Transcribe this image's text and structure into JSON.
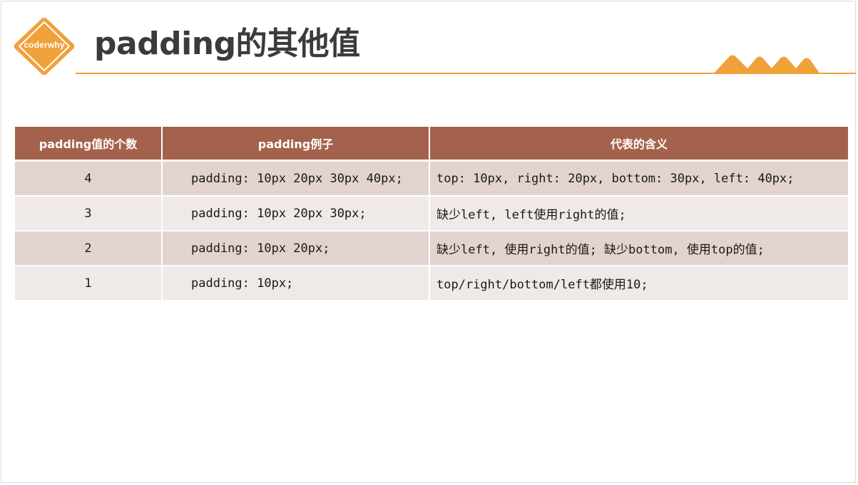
{
  "logo": {
    "text": "coderwhy",
    "color": "#f0a13a"
  },
  "title": "padding的其他值",
  "accent_color": "#f0a13a",
  "table": {
    "header_color": "#a4624c",
    "headers": [
      "padding值的个数",
      "padding例子",
      "代表的含义"
    ],
    "rows": [
      [
        "4",
        "padding: 10px 20px 30px 40px;",
        "top: 10px, right: 20px, bottom: 30px, left: 40px;"
      ],
      [
        "3",
        "padding: 10px 20px 30px;",
        "缺少left, left使用right的值;"
      ],
      [
        "2",
        "padding: 10px 20px;",
        "缺少left, 使用right的值; 缺少bottom, 使用top的值;"
      ],
      [
        "1",
        "padding: 10px;",
        "top/right/bottom/left都使用10;"
      ]
    ]
  }
}
